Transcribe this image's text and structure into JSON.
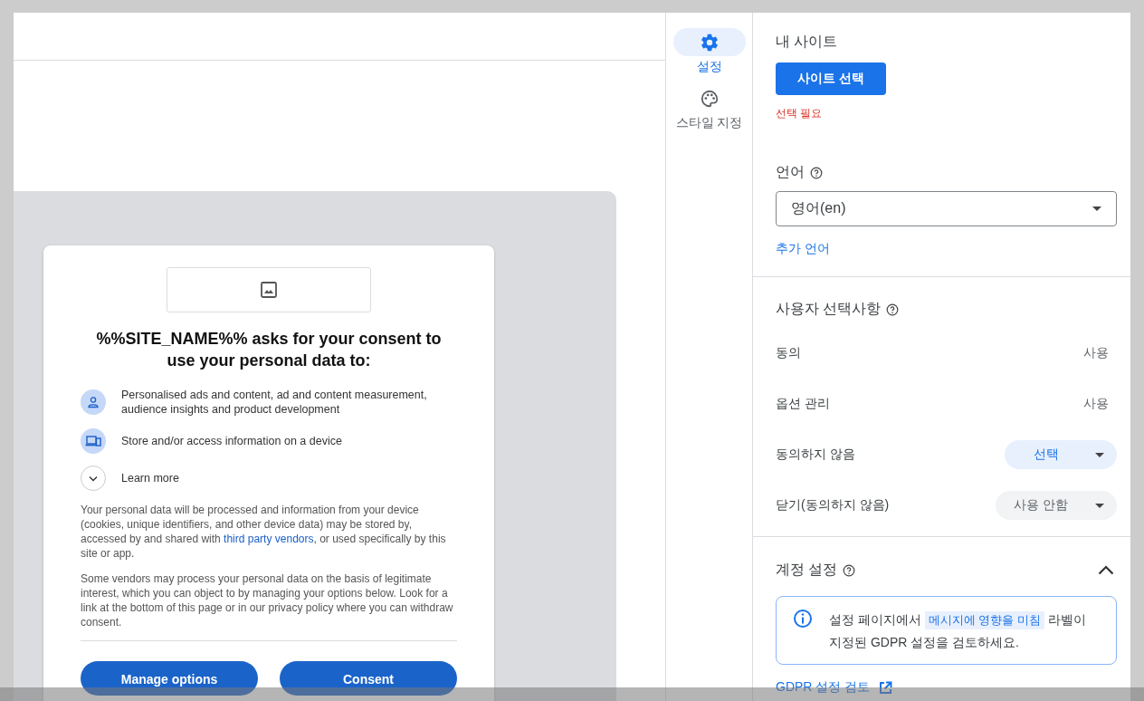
{
  "consent_preview": {
    "title": "%%SITE_NAME%% asks for your consent to use your personal data to:",
    "purposes": [
      {
        "kind": "person",
        "text": "Personalised ads and content, ad and content measurement, audience insights and product development"
      },
      {
        "kind": "device",
        "text": "Store and/or access information on a device"
      }
    ],
    "learn_more": {
      "label": "Learn more",
      "expanded": false
    },
    "notice": {
      "before": "Your personal data will be processed and information from your device (cookies, unique identifiers, and other device data) may be stored by, accessed by and shared with ",
      "link": "third party vendors",
      "after": ", or used specifically by this site or app."
    },
    "legitimate_interest": "Some vendors may process your personal data on the basis of legitimate interest, which you can object to by managing your options below. Look for a link at the bottom of this page or in our privacy policy where you can withdraw consent.",
    "buttons": [
      "Manage options",
      "Consent"
    ]
  },
  "nav_rail": [
    {
      "kind": "gear",
      "label": "설정",
      "selected": true
    },
    {
      "kind": "palette",
      "label": "스타일 지정",
      "selected": false
    }
  ],
  "settings": {
    "my_site": {
      "label": "내 사이트",
      "button": "사이트 선택",
      "error": "선택 필요"
    },
    "language": {
      "label": "언어",
      "value": "영어(en)",
      "link": "추가 언어"
    },
    "user_choices": {
      "title": "사용자 선택사항",
      "rows": [
        {
          "label": "동의",
          "kind": "text",
          "value": "사용"
        },
        {
          "label": "옵션 관리",
          "kind": "text",
          "value": "사용"
        },
        {
          "label": "동의하지 않음",
          "kind": "dropdown",
          "value": "선택",
          "highlighted": true
        },
        {
          "label": "닫기(동의하지 않음)",
          "kind": "dropdown",
          "value": "사용 안함",
          "highlighted": false
        }
      ]
    },
    "account": {
      "title": "계정 설정",
      "expanded": true,
      "info_before": "설정 페이지에서 ",
      "info_chip": "메시지에 영향을 미침",
      "info_after": " 라벨이 지정된 GDPR 설정을 검토하세요.",
      "link": "GDPR 설정 검토"
    }
  }
}
